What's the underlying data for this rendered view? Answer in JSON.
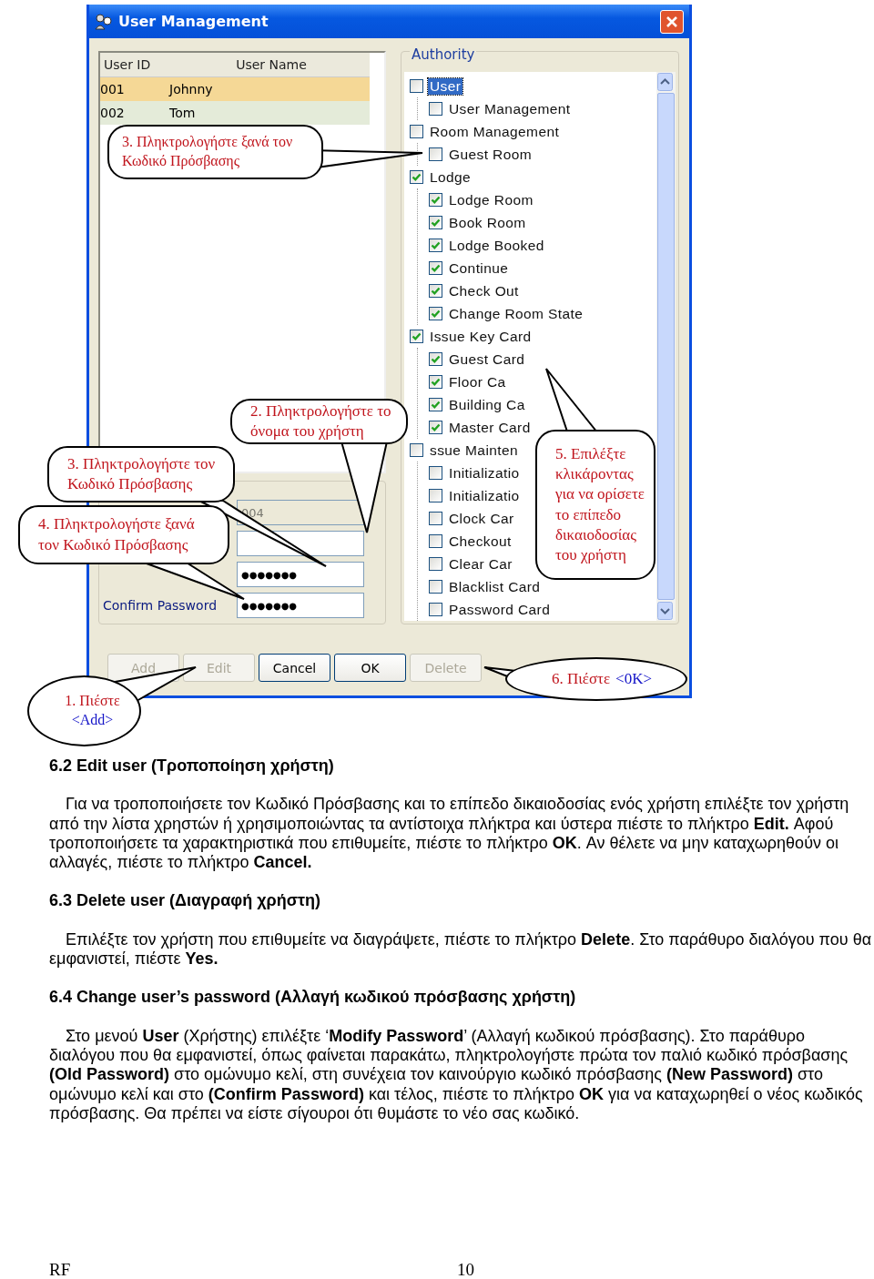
{
  "window": {
    "title": "User Management"
  },
  "user_list": {
    "columns": [
      "User ID",
      "User Name"
    ],
    "rows": [
      {
        "cells": [
          "001",
          "Johnny"
        ],
        "selected": true
      },
      {
        "cells": [
          "002",
          "Tom"
        ],
        "selected": false
      }
    ]
  },
  "form_fields": [
    {
      "kind": "text",
      "disabled": true,
      "value": "004"
    },
    {
      "kind": "text",
      "disabled": false
    },
    {
      "kind": "password",
      "disabled": false,
      "value": "●●●●●●●"
    },
    {
      "kind": "password",
      "disabled": false,
      "label": "Confirm Password",
      "value": "●●●●●●●"
    }
  ],
  "authority": {
    "title": "Authority",
    "items": [
      {
        "label": "User",
        "checked": false,
        "selected": true,
        "children": [
          {
            "label": "User Management",
            "checked": false,
            "selected": false
          }
        ]
      },
      {
        "label": "Room Management",
        "checked": false,
        "selected": false,
        "children": [
          {
            "label": "Guest Room",
            "checked": false,
            "selected": false
          }
        ]
      },
      {
        "label": "Lodge",
        "checked": true,
        "selected": false,
        "children": [
          {
            "label": "Lodge Room",
            "checked": true,
            "selected": false
          },
          {
            "label": "Book Room",
            "checked": true,
            "selected": false
          },
          {
            "label": "Lodge Booked",
            "checked": true,
            "selected": false
          },
          {
            "label": "Continue",
            "checked": true,
            "selected": false
          },
          {
            "label": "Check Out",
            "checked": true,
            "selected": false
          },
          {
            "label": "Change Room State",
            "checked": true,
            "selected": false
          }
        ]
      },
      {
        "label": "Issue Key Card",
        "checked": true,
        "selected": false,
        "children": [
          {
            "label": "Guest Card",
            "checked": true,
            "selected": false
          },
          {
            "label": "Floor Ca",
            "checked": true,
            "selected": false
          },
          {
            "label": "Building Ca",
            "checked": true,
            "selected": false
          },
          {
            "label": "Master Card",
            "checked": true,
            "selected": false
          }
        ]
      },
      {
        "label": "ssue Mainten",
        "checked": false,
        "selected": false,
        "children": [
          {
            "label": "Initializatio",
            "checked": false,
            "selected": false
          },
          {
            "label": "Initializatio",
            "checked": false,
            "selected": false
          },
          {
            "label": "Clock Car",
            "checked": false,
            "selected": false
          },
          {
            "label": "Checkout",
            "checked": false,
            "selected": false
          },
          {
            "label": "Clear Car",
            "checked": false,
            "selected": false
          },
          {
            "label": "Blacklist Card",
            "checked": false,
            "selected": false
          },
          {
            "label": "Password Card",
            "checked": false,
            "selected": false
          }
        ]
      }
    ]
  },
  "buttons": [
    {
      "label": "Add",
      "disabled": true
    },
    {
      "label": "Edit",
      "disabled": true
    },
    {
      "label": "Cancel",
      "disabled": false
    },
    {
      "label": "OK",
      "disabled": false
    },
    {
      "label": "Delete",
      "disabled": true
    }
  ],
  "callouts": [
    {
      "kind": "rounded",
      "text": "3. Πληκτρολογήστε ξανά τον Κωδικό Πρόσβασης"
    },
    {
      "kind": "rounded",
      "text": "2. Πληκτρολογήστε το όνομα του χρήστη"
    },
    {
      "kind": "rounded",
      "text": "3. Πληκτρολογήστε τον Κωδικό Πρόσβασης"
    },
    {
      "kind": "rounded",
      "text": "4. Πληκτρολογήστε ξανά τον Κωδικό Πρόσβασης"
    },
    {
      "kind": "ellipse",
      "text": "1. Πιέστε",
      "tag": "<Add>"
    },
    {
      "kind": "rounded",
      "text": "5. Επιλέξτε κλικάροντας για να ορίσετε το επίπεδο δικαιοδοσίας του χρήστη"
    },
    {
      "kind": "ellipse",
      "text": "6. Πιέστε",
      "tag": "<0K>"
    }
  ],
  "document": {
    "sections": [
      {
        "heading": "6.2  Edit user (Τροποποίηση χρήστη)",
        "paragraph": "Για να τροποποιήσετε τον Κωδικό Πρόσβασης και το επίπεδο δικαιοδοσίας ενός χρήστη επιλέξτε τον χρήστη από την λίστα χρηστών ή χρησιμοποιώντας τα αντίστοιχα πλήκτρα και ύστερα πιέστε το πλήκτρο **Edit.** Αφού τροποποιήσετε τα χαρακτηριστικά που επιθυμείτε, πιέστε το πλήκτρο **OK**. Αν θέλετε να μην καταχωρηθούν οι αλλαγές, πιέστε το πλήκτρο **Cancel.**"
      },
      {
        "heading": "6.3  Delete user (Διαγραφή χρήστη)",
        "paragraph": "Επιλέξτε τον χρήστη που επιθυμείτε να διαγράψετε, πιέστε το πλήκτρο **Delete**. Στο παράθυρο διαλόγου που θα εμφανιστεί, πιέστε **Yes.**"
      },
      {
        "heading": "6.4  Change user’s password (Αλλαγή κωδικού πρόσβασης χρήστη)",
        "paragraph": "Στο μενού **User** (Χρήστης) επιλέξτε ‘**Modify Password**’ (Αλλαγή κωδικού πρόσβασης). Στο παράθυρο διαλόγου που θα εμφανιστεί, όπως φαίνεται παρακάτω, πληκτρολογήστε πρώτα τον παλιό κωδικό πρόσβασης **(Old Password)** στο ομώνυμο κελί, στη συνέχεια τον καινούργιο κωδικό πρόσβασης **(New Password)** στο ομώνυμο κελί και στο **(Confirm Password)** και τέλος, πιέστε το πλήκτρο **OK** για να καταχωρηθεί ο νέος κωδικός πρόσβασης. Θα πρέπει να είστε σίγουροι ότι θυμάστε το νέο σας κωδικό."
      }
    ]
  },
  "footer": {
    "left": "RF",
    "page": "10"
  }
}
